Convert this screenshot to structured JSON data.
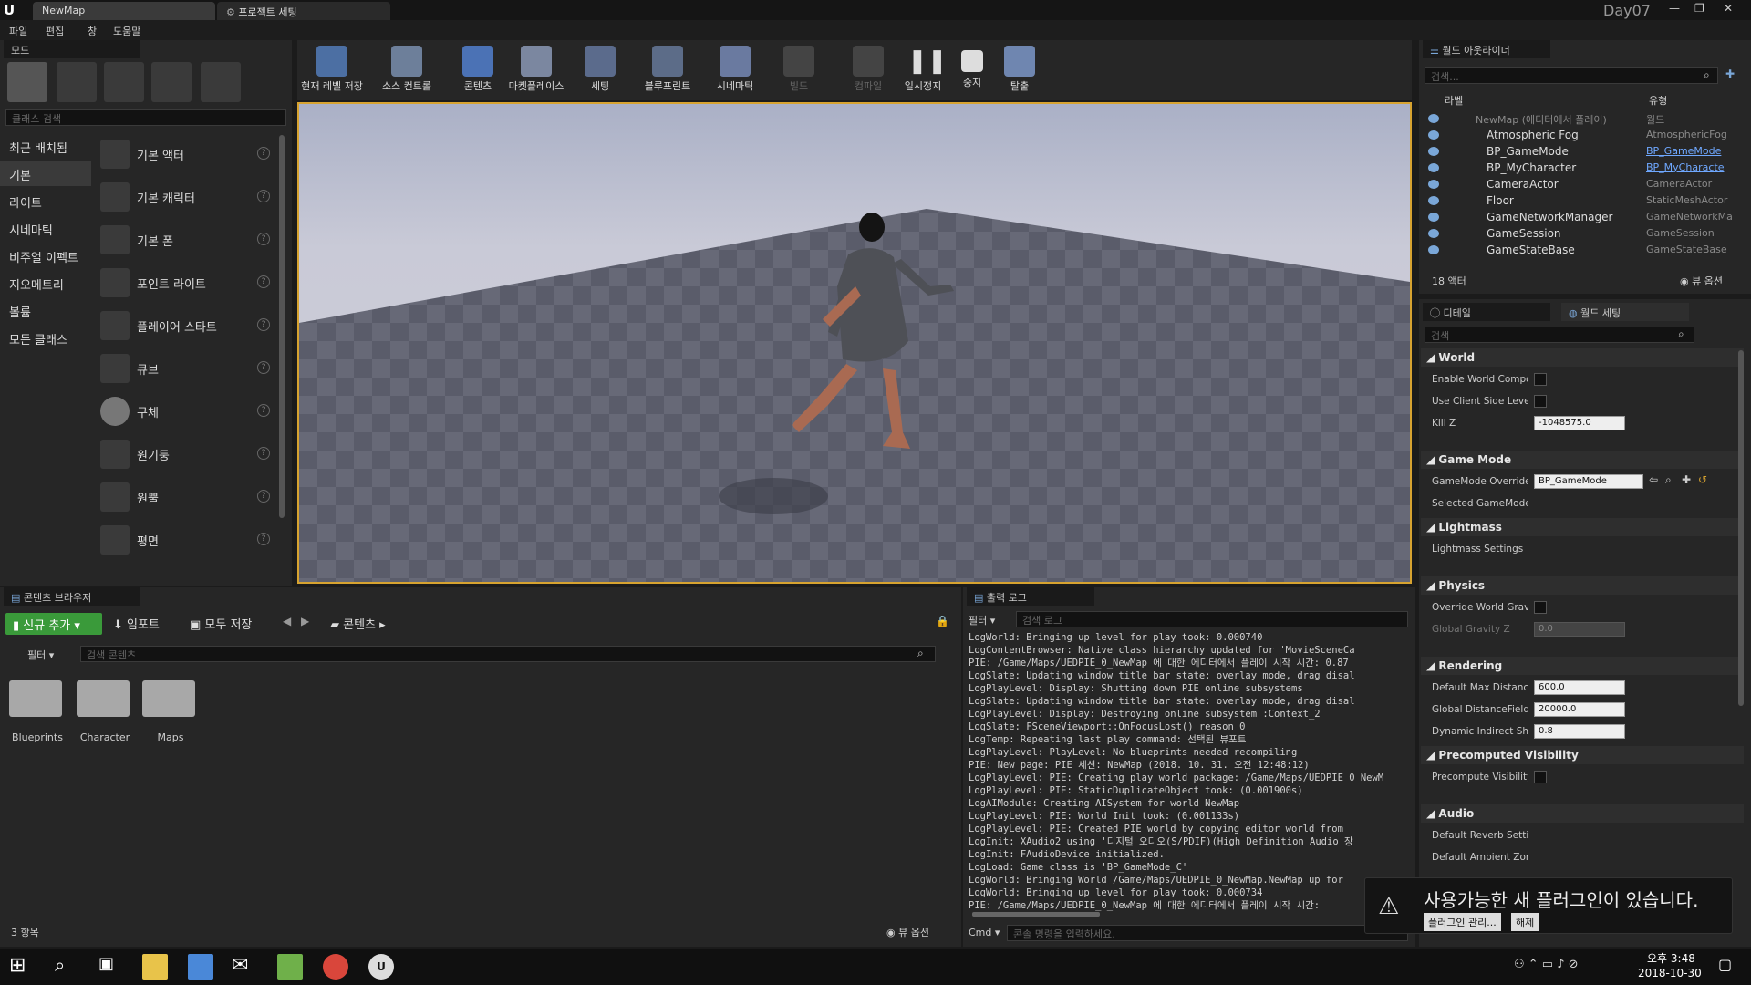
{
  "tabs": {
    "map": "NewMap",
    "project": "프로젝트 세팅",
    "project_name": "Day07"
  },
  "menu": [
    "파일",
    "편집",
    "창",
    "도움말"
  ],
  "modes": {
    "title": "모드",
    "search_placeholder": "클래스 검색",
    "categories": [
      "최근 배치됨",
      "기본",
      "라이트",
      "시네마틱",
      "비주얼 이펙트",
      "지오메트리",
      "볼륨",
      "모든 클래스"
    ],
    "items": [
      "기본 액터",
      "기본 캐릭터",
      "기본 폰",
      "포인트 라이트",
      "플레이어 스타트",
      "큐브",
      "구체",
      "원기둥",
      "원뿔",
      "평면"
    ]
  },
  "toolbar": [
    "현재 레벨 저장",
    "소스 컨트롤",
    "콘텐츠",
    "마켓플레이스",
    "세팅",
    "블루프린트",
    "시네마틱",
    "빌드",
    "컴파일",
    "일시정지",
    "중지",
    "탈출"
  ],
  "outliner": {
    "title": "월드 아웃라이너",
    "search_placeholder": "검색...",
    "col_label": "라벨",
    "col_type": "유형",
    "root": {
      "name": "NewMap (에디터에서 플레이)",
      "type": "월드"
    },
    "rows": [
      {
        "name": "Atmospheric Fog",
        "type": "AtmosphericFog",
        "link": false
      },
      {
        "name": "BP_GameMode",
        "type": "BP_GameMode",
        "link": true
      },
      {
        "name": "BP_MyCharacter",
        "type": "BP_MyCharacte",
        "link": true
      },
      {
        "name": "CameraActor",
        "type": "CameraActor",
        "link": false
      },
      {
        "name": "Floor",
        "type": "StaticMeshActor",
        "link": false
      },
      {
        "name": "GameNetworkManager",
        "type": "GameNetworkMa",
        "link": false
      },
      {
        "name": "GameSession",
        "type": "GameSession",
        "link": false
      },
      {
        "name": "GameStateBase",
        "type": "GameStateBase",
        "link": false
      }
    ],
    "count": "18 액터",
    "view_options": "뷰 옵션"
  },
  "details": {
    "tab1": "디테일",
    "tab2": "월드 세팅",
    "search_placeholder": "검색",
    "sections": {
      "world": "World",
      "gamemode": "Game Mode",
      "lightmass": "Lightmass",
      "physics": "Physics",
      "rendering": "Rendering",
      "precomputed": "Precomputed Visibility",
      "audio": "Audio"
    },
    "props": {
      "enable_world": "Enable World Compo",
      "use_client": "Use Client Side Leve",
      "kill_z": "Kill Z",
      "kill_z_val": "-1048575.0",
      "gm_override": "GameMode Override",
      "gm_val": "BP_GameMode",
      "selected_gm": "Selected GameMode",
      "lm_settings": "Lightmass Settings",
      "override_grav": "Override World Gravi",
      "global_grav": "Global Gravity Z",
      "global_grav_val": "0.0",
      "max_dist": "Default Max Distanc",
      "max_dist_val": "600.0",
      "global_df": "Global DistanceField",
      "global_df_val": "20000.0",
      "dyn_indirect": "Dynamic Indirect Sha",
      "dyn_val": "0.8",
      "precompute": "Precompute Visibility",
      "reverb": "Default Reverb Setti",
      "ambient": "Default Ambient Zon"
    }
  },
  "content": {
    "title": "콘텐츠 브라우저",
    "add_new": "신규 추가",
    "import": "임포트",
    "save_all": "모두 저장",
    "path": "콘텐츠",
    "filter": "필터",
    "search_placeholder": "검색 콘텐츠",
    "folders": [
      "Blueprints",
      "Character",
      "Maps"
    ],
    "count": "3 항목",
    "view_options": "뷰 옵션"
  },
  "output": {
    "title": "출력 로그",
    "filter": "필터",
    "search_placeholder": "검색 로그",
    "cmd": "Cmd",
    "cmd_placeholder": "콘솔 명령을 입력하세요.",
    "lines": [
      "LogWorld: Bringing up level for play took: 0.000740",
      "LogContentBrowser: Native class hierarchy updated for 'MovieSceneCa",
      "PIE: /Game/Maps/UEDPIE_0_NewMap 에 대한 에디터에서 플레이 시작 시간: 0.87",
      "LogSlate: Updating window title bar state: overlay mode, drag disal",
      "LogPlayLevel: Display: Shutting down PIE online subsystems",
      "LogSlate: Updating window title bar state: overlay mode, drag disal",
      "LogPlayLevel: Display: Destroying online subsystem :Context_2",
      "LogSlate: FSceneViewport::OnFocusLost() reason 0",
      "LogTemp: Repeating last play command: 선택된 뷰포트",
      "LogPlayLevel: PlayLevel: No blueprints needed recompiling",
      "PIE: New page: PIE 세션: NewMap (2018. 10. 31. 오전 12:48:12)",
      "LogPlayLevel: PIE: Creating play world package: /Game/Maps/UEDPIE_0_NewM",
      "LogPlayLevel: PIE: StaticDuplicateObject took: (0.001900s)",
      "LogAIModule: Creating AISystem for world NewMap",
      "LogPlayLevel: PIE: World Init took: (0.001133s)",
      "LogPlayLevel: PIE: Created PIE world by copying editor world from ",
      "LogInit: XAudio2 using '디지털 오디오(S/PDIF)(High Definition Audio 장",
      "LogInit: FAudioDevice initialized.",
      "LogLoad: Game class is 'BP_GameMode_C'",
      "LogWorld: Bringing World /Game/Maps/UEDPIE_0_NewMap.NewMap up for",
      "LogWorld: Bringing up level for play took: 0.000734",
      "PIE: /Game/Maps/UEDPIE_0_NewMap 에 대한 에디터에서 플레이 시작 시간:"
    ]
  },
  "notification": {
    "text": "사용가능한 새 플러그인이 있습니다.",
    "manage": "플러그인 관리...",
    "dismiss": "해제"
  },
  "taskbar": {
    "time": "오후 3:48",
    "date": "2018-10-30"
  }
}
